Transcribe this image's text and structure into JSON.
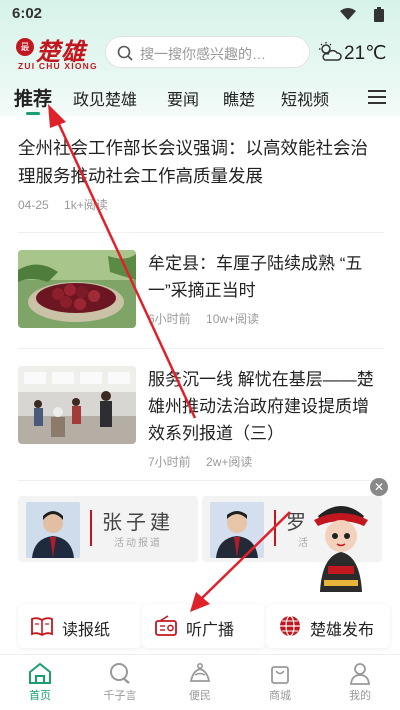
{
  "status_bar": {
    "time": "6:02"
  },
  "header": {
    "logo_text": "楚雄",
    "logo_pinyin": "ZUI CHU XIONG",
    "search_placeholder": "搜一搜你感兴趣的…",
    "weather": {
      "icon": "partly-cloudy-icon",
      "temperature": "21℃"
    }
  },
  "nav": {
    "tabs": [
      {
        "label": "推荐",
        "active": true
      },
      {
        "label": "政见楚雄"
      },
      {
        "label": "要闻"
      },
      {
        "label": "瞧楚"
      },
      {
        "label": "短视频"
      }
    ],
    "menu_icon": "hamburger-icon"
  },
  "feed": {
    "articles": [
      {
        "title": "全州社会工作部长会议强调：以高效能社会治理服务推动社会工作高质量发展",
        "date": "04-25",
        "reads": "1k+阅读"
      },
      {
        "title": "牟定县：车厘子陆续成熟 “五一”采摘正当时",
        "date": "6小时前",
        "reads": "10w+阅读"
      },
      {
        "title": "服务沉一线 解忧在基层——楚雄州推动法治政府建设提质增效系列报道（三）",
        "date": "7小时前",
        "reads": "2w+阅读"
      }
    ],
    "leader_cards": [
      {
        "name": "张子建",
        "subtitle": "活动报道"
      },
      {
        "name": "罗",
        "subtitle": "活"
      }
    ]
  },
  "quick_links": [
    {
      "label": "读报纸",
      "icon": "open-book-icon"
    },
    {
      "label": "听广播",
      "icon": "radio-icon"
    },
    {
      "label": "楚雄发布",
      "icon": "globe-icon"
    }
  ],
  "tab_bar": [
    {
      "label": "首页",
      "icon": "home-icon",
      "active": true
    },
    {
      "label": "千子言",
      "icon": "chat-icon"
    },
    {
      "label": "便民",
      "icon": "service-icon"
    },
    {
      "label": "商城",
      "icon": "shopping-bag-icon"
    },
    {
      "label": "我的",
      "icon": "user-icon"
    }
  ],
  "colors": {
    "accent": "#1aa06f",
    "brand_red": "#c3171f",
    "annotation_arrow": "#e0202a"
  }
}
